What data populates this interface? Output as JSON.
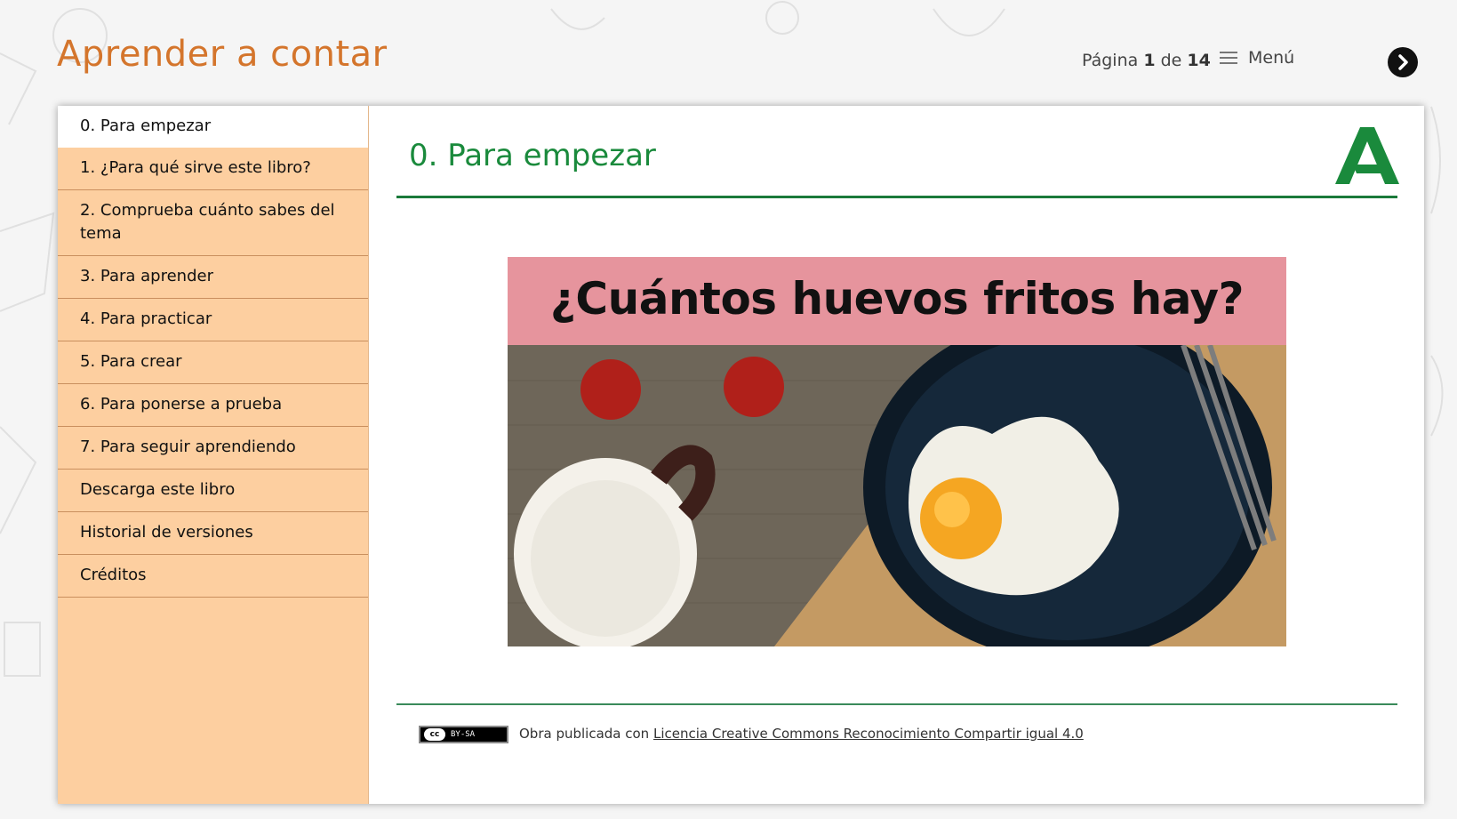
{
  "header": {
    "title": "Aprender a contar",
    "pager_prefix": "Página",
    "page_current": "1",
    "pager_middle": "de",
    "page_total": "14",
    "menu_label": "Menú"
  },
  "sidebar": {
    "items": [
      {
        "label": "0. Para empezar",
        "active": true
      },
      {
        "label": "1. ¿Para qué sirve este libro?"
      },
      {
        "label": "2. Comprueba cuánto sabes del tema"
      },
      {
        "label": "3. Para aprender"
      },
      {
        "label": "4. Para practicar"
      },
      {
        "label": "5. Para crear"
      },
      {
        "label": "6. Para ponerse a prueba"
      },
      {
        "label": "7. Para seguir aprendiendo"
      },
      {
        "label": "Descarga este libro"
      },
      {
        "label": "Historial de versiones"
      },
      {
        "label": "Créditos"
      }
    ]
  },
  "main": {
    "heading": "0. Para empezar",
    "hero_title": "¿Cuántos huevos fritos hay?"
  },
  "footer": {
    "badge_cc": "cc",
    "badge_text": "BY-SA",
    "license_prefix": "Obra publicada con",
    "license_link": "Licencia Creative Commons Reconocimiento Compartir igual 4.0"
  },
  "colors": {
    "title_orange": "#d4752c",
    "heading_green": "#1a8a3c",
    "sidebar_bg": "#fdcfa0",
    "hero_band": "#e6949d"
  },
  "icons": {
    "menu": "hamburger-icon",
    "next": "chevron-right-icon",
    "logo": "junta-andalucia-logo"
  }
}
